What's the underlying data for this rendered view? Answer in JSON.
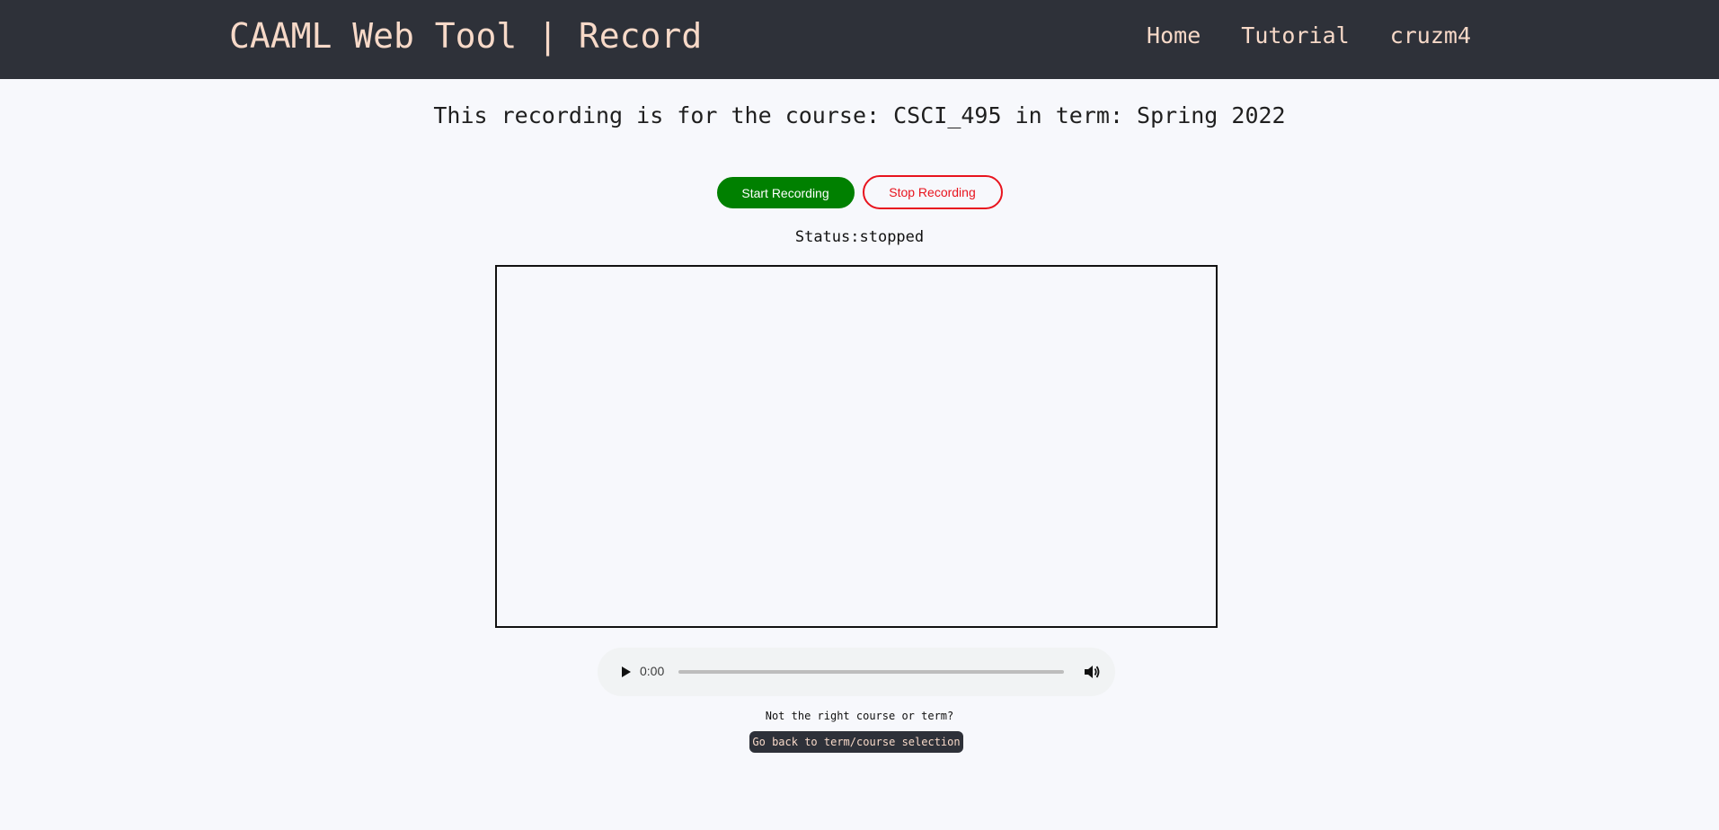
{
  "header": {
    "title": "CAAML Web Tool | Record",
    "nav": {
      "home": "Home",
      "tutorial": "Tutorial",
      "user": "cruzm4"
    }
  },
  "main": {
    "course_heading": "This recording is for the course: CSCI_495 in term: Spring 2022",
    "start_button": "Start Recording",
    "stop_button": "Stop Recording",
    "status": "Status:stopped"
  },
  "audio": {
    "current_time": "0:00",
    "play_icon": "play-icon",
    "volume_icon": "volume-icon"
  },
  "footer": {
    "prompt": "Not the right course or term?",
    "back_button": "Go back to term/course selection"
  },
  "colors": {
    "navbar_bg": "#2e3139",
    "nav_text": "#f7d9c8",
    "start_green": "#008000",
    "stop_red": "#e8141e",
    "page_bg": "#f7f8fc"
  }
}
